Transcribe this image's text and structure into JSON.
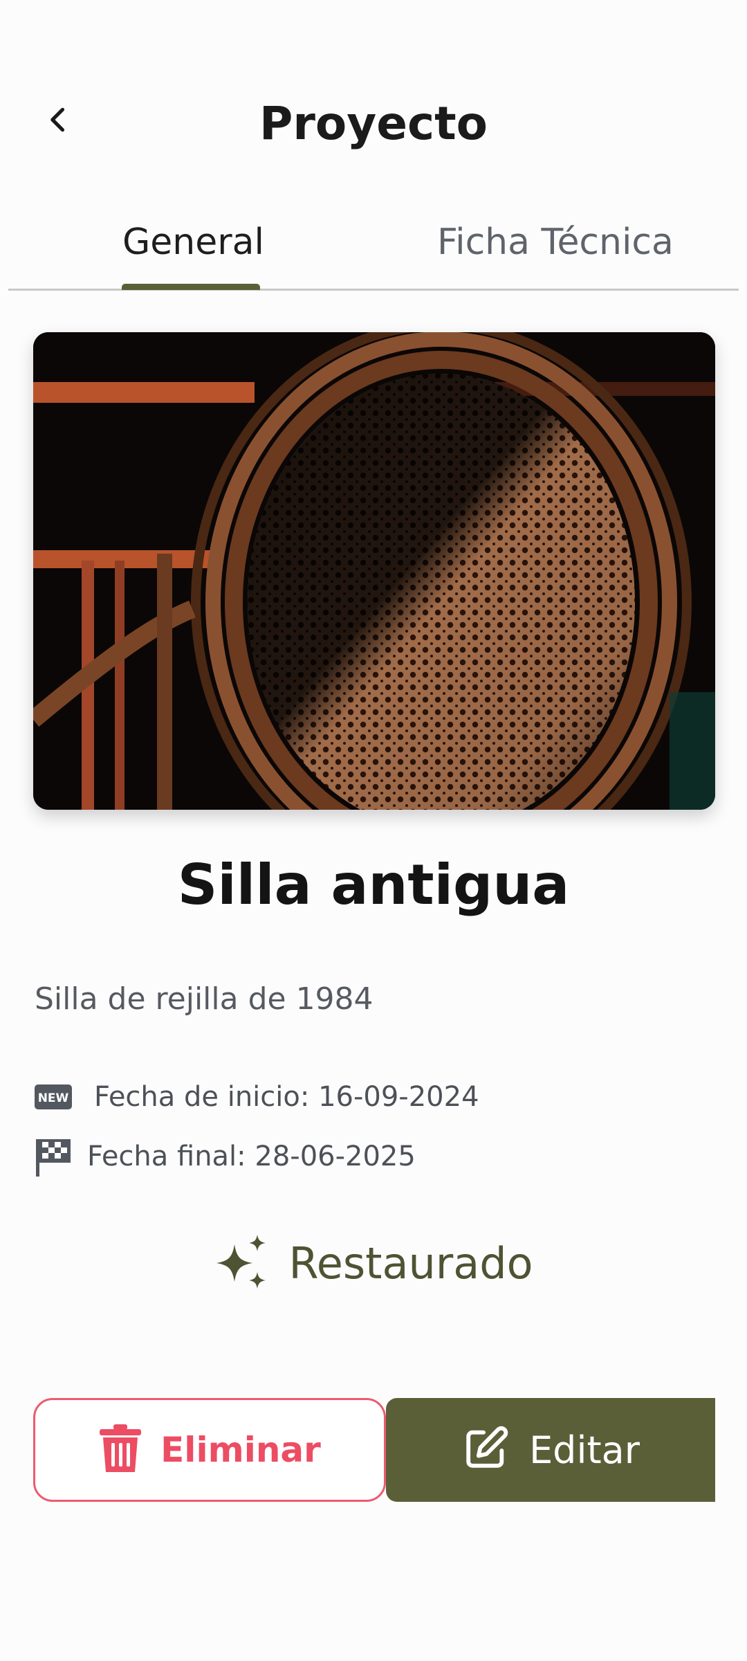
{
  "header": {
    "title": "Proyecto",
    "back_icon": "chevron-left-icon"
  },
  "tabs": [
    {
      "label": "General",
      "active": true
    },
    {
      "label": "Ficha Técnica",
      "active": false
    }
  ],
  "project": {
    "name": "Silla antigua",
    "description": "Silla de rejilla de 1984",
    "start_date_label": "Fecha de inicio: 16-09-2024",
    "end_date_label": "Fecha final: 28-06-2025",
    "status": "Restaurado",
    "start_icon": "new-badge-icon",
    "end_icon": "checkered-flag-icon",
    "status_icon": "sparkles-icon",
    "image_icon": "cane-chair-photo"
  },
  "actions": {
    "delete_label": "Eliminar",
    "edit_label": "Editar",
    "delete_icon": "trash-icon",
    "edit_icon": "edit-icon"
  },
  "colors": {
    "accent": "#5b5f38",
    "danger": "#ec4d63",
    "background": "#fcfcfd"
  }
}
